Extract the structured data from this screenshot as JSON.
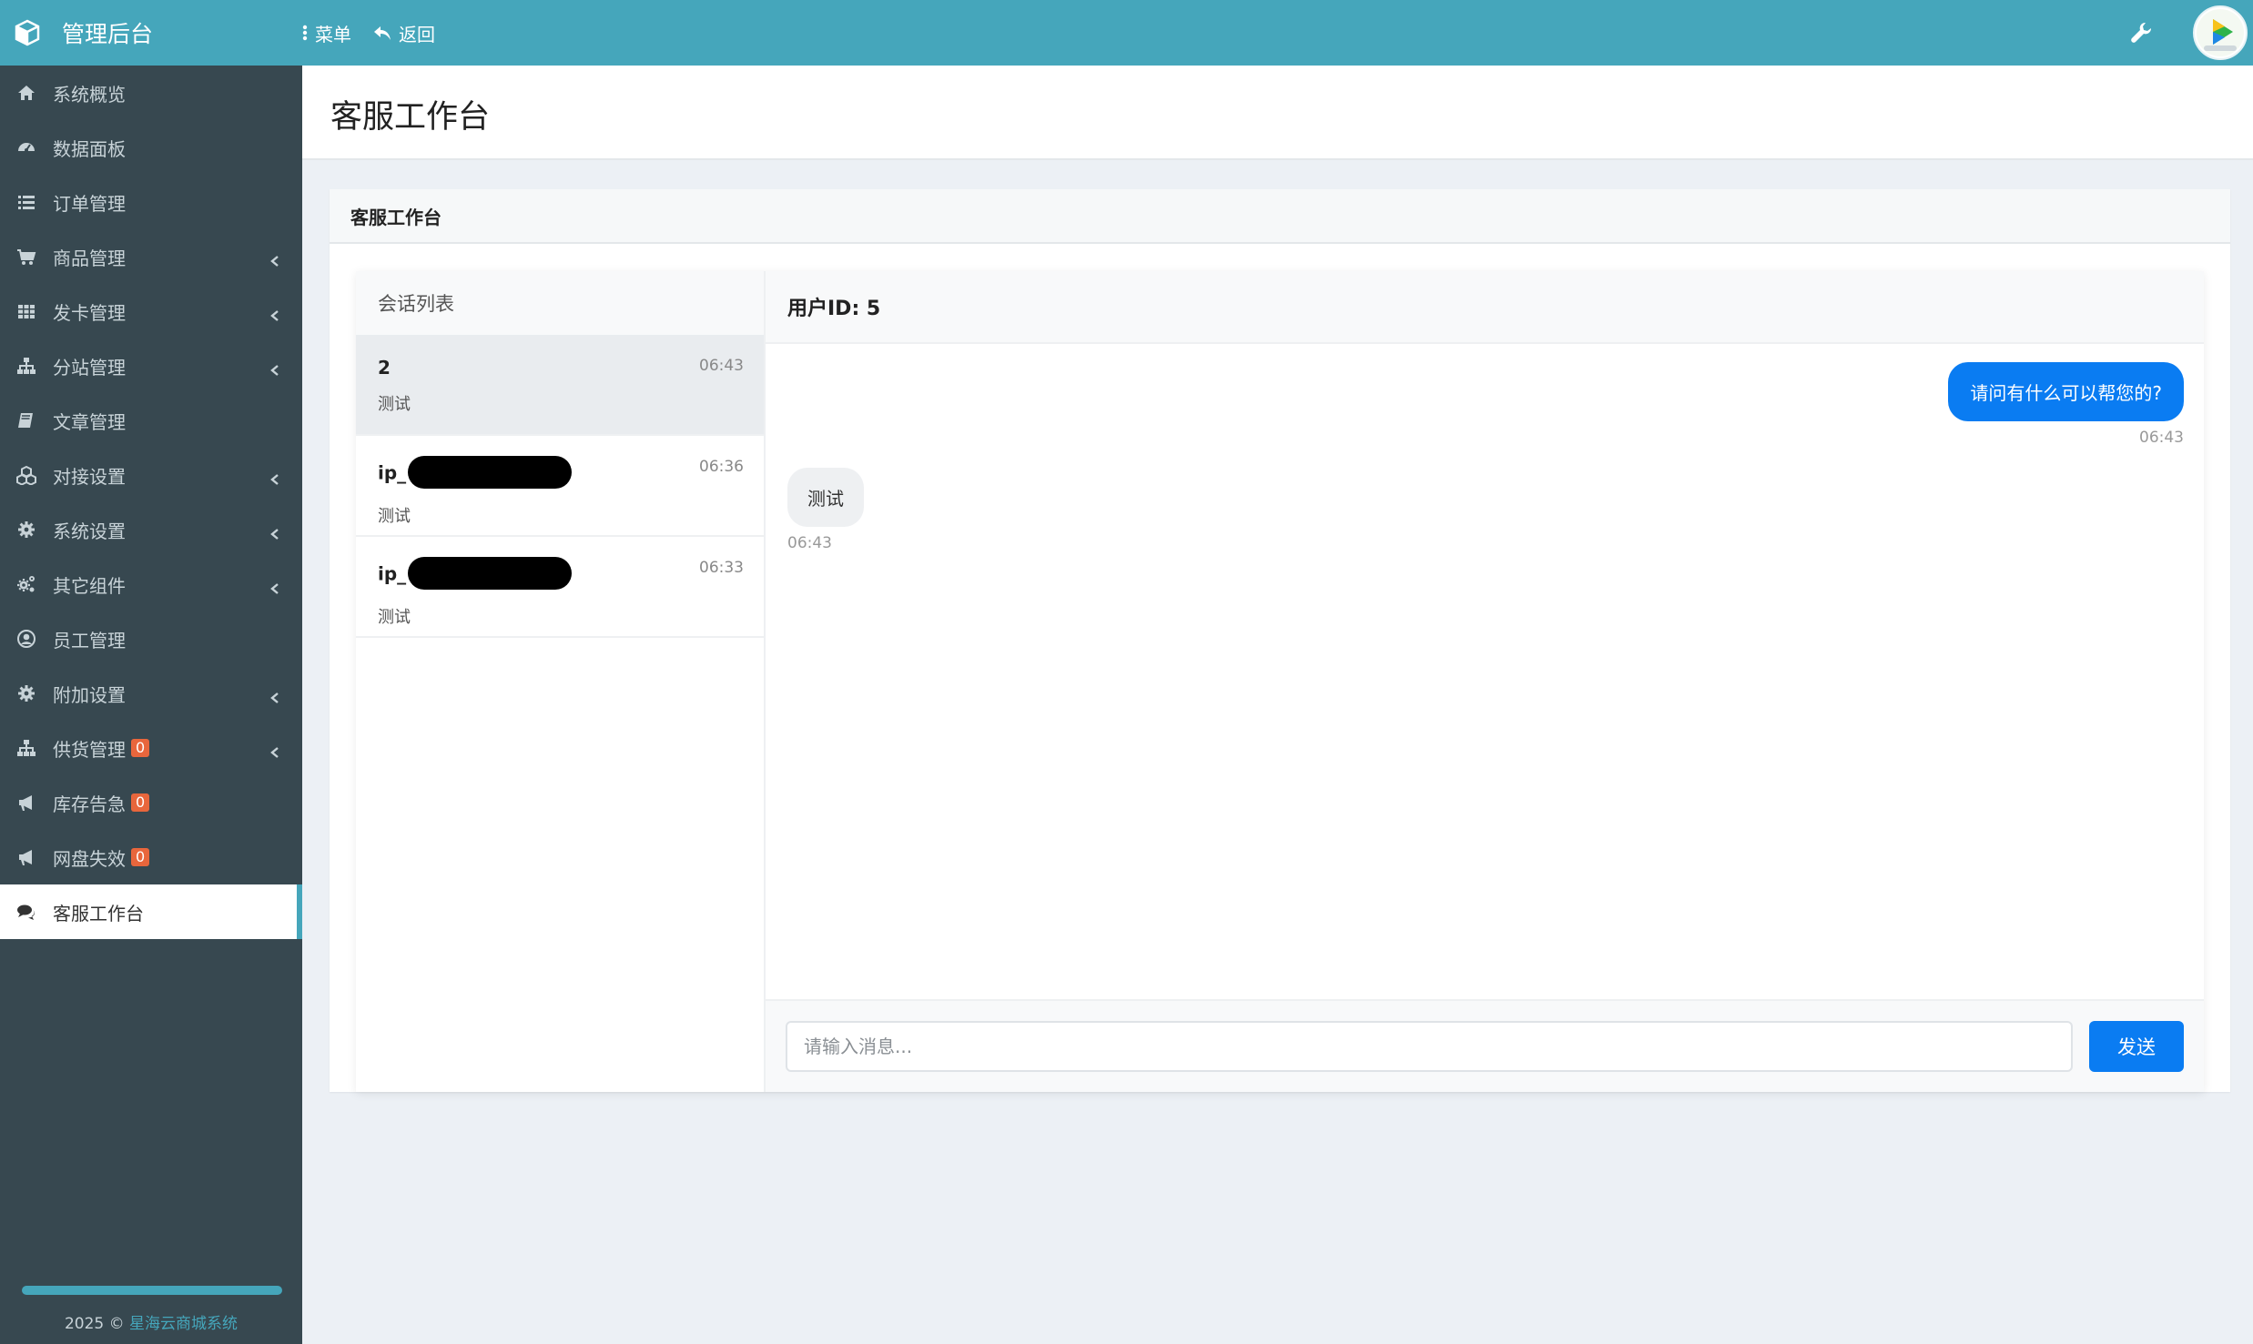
{
  "header": {
    "brand_title": "管理后台",
    "menu_label": "菜单",
    "back_label": "返回"
  },
  "sidebar": {
    "items": [
      {
        "label": "系统概览",
        "icon": "home-icon",
        "has_arrow": false
      },
      {
        "label": "数据面板",
        "icon": "dashboard-icon",
        "has_arrow": false
      },
      {
        "label": "订单管理",
        "icon": "list-icon",
        "has_arrow": false
      },
      {
        "label": "商品管理",
        "icon": "cart-icon",
        "has_arrow": true
      },
      {
        "label": "发卡管理",
        "icon": "grid-icon",
        "has_arrow": true
      },
      {
        "label": "分站管理",
        "icon": "sitemap-icon",
        "has_arrow": true
      },
      {
        "label": "文章管理",
        "icon": "book-icon",
        "has_arrow": false
      },
      {
        "label": "对接设置",
        "icon": "cubes-icon",
        "has_arrow": true
      },
      {
        "label": "系统设置",
        "icon": "gear-icon",
        "has_arrow": true
      },
      {
        "label": "其它组件",
        "icon": "gears-icon",
        "has_arrow": true
      },
      {
        "label": "员工管理",
        "icon": "user-circle-icon",
        "has_arrow": false
      },
      {
        "label": "附加设置",
        "icon": "gear-icon",
        "has_arrow": true
      },
      {
        "label": "供货管理",
        "icon": "sitemap-icon",
        "has_arrow": true,
        "badge": "0"
      },
      {
        "label": "库存告急",
        "icon": "bullhorn-icon",
        "has_arrow": false,
        "badge": "0"
      },
      {
        "label": "网盘失效",
        "icon": "bullhorn-icon",
        "has_arrow": false,
        "badge": "0"
      },
      {
        "label": "客服工作台",
        "icon": "comments-icon",
        "has_arrow": false,
        "active": true
      }
    ],
    "footer_prefix": "2025 © ",
    "footer_link": "星海云商城系统"
  },
  "page": {
    "title": "客服工作台",
    "box_title": "客服工作台"
  },
  "conversations": {
    "heading": "会话列表",
    "items": [
      {
        "name": "2",
        "time": "06:43",
        "message": "测试",
        "active": true
      },
      {
        "name": "ip_",
        "time": "06:36",
        "message": "测试",
        "redacted": true
      },
      {
        "name": "ip_",
        "time": "06:33",
        "message": "测试",
        "redacted": true
      }
    ]
  },
  "chat": {
    "header": "用户ID: 5",
    "messages": [
      {
        "direction": "out",
        "text": "请问有什么可以帮您的?",
        "time": "06:43"
      },
      {
        "direction": "in",
        "text": "测试",
        "time": "06:43"
      }
    ],
    "input_placeholder": "请输入消息...",
    "send_label": "发送"
  },
  "colors": {
    "header_bg": "#45a6bb",
    "sidebar_bg": "#374850",
    "accent_blue": "#0a7cf2",
    "badge": "#e8663c"
  }
}
